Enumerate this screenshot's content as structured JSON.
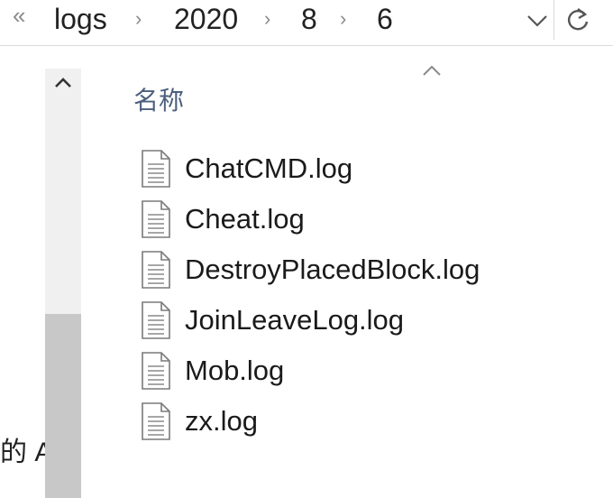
{
  "address_bar": {
    "overflow_glyph": "«",
    "breadcrumbs": [
      "logs",
      "2020",
      "8",
      "6"
    ],
    "separator_glyph": "›",
    "dropdown_icon": "chevron-down-icon",
    "refresh_icon": "refresh-icon"
  },
  "nav_pane": {
    "truncated_text": "的 A",
    "scroll_up_icon": "chevron-up-icon"
  },
  "file_list": {
    "column_header": "名称",
    "sort_indicator": "sort-ascending-icon",
    "files": [
      {
        "name": "ChatCMD.log",
        "icon": "text-file-icon"
      },
      {
        "name": "Cheat.log",
        "icon": "text-file-icon"
      },
      {
        "name": "DestroyPlacedBlock.log",
        "icon": "text-file-icon"
      },
      {
        "name": "JoinLeaveLog.log",
        "icon": "text-file-icon"
      },
      {
        "name": "Mob.log",
        "icon": "text-file-icon"
      },
      {
        "name": "zx.log",
        "icon": "text-file-icon"
      }
    ]
  }
}
